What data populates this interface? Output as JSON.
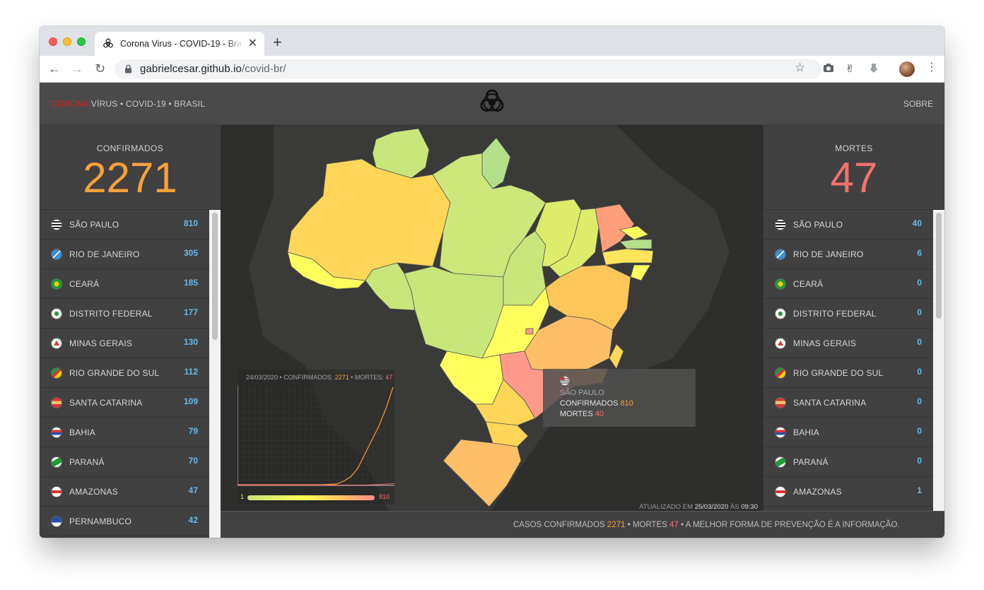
{
  "browser": {
    "tab_title": "Corona Virus - COVID-19 - Bra",
    "url_host": "gabrielcesar.github.io",
    "url_path": "/covid-br/"
  },
  "header": {
    "brand_red": "CORONA",
    "brand_rest": " VÍRUS • COVID-19 • BRASIL",
    "about": "SOBRE",
    "logo_icon": "biohazard-icon"
  },
  "confirmed": {
    "label": "CONFIRMADOS",
    "total": "2271",
    "states": [
      {
        "name": "SÃO PAULO",
        "value": "810"
      },
      {
        "name": "RIO DE JANEIRO",
        "value": "305"
      },
      {
        "name": "CEARÁ",
        "value": "185"
      },
      {
        "name": "DISTRITO FEDERAL",
        "value": "177"
      },
      {
        "name": "MINAS GERAIS",
        "value": "130"
      },
      {
        "name": "RIO GRANDE DO SUL",
        "value": "112"
      },
      {
        "name": "SANTA CATARINA",
        "value": "109"
      },
      {
        "name": "BAHIA",
        "value": "79"
      },
      {
        "name": "PARANÁ",
        "value": "70"
      },
      {
        "name": "AMAZONAS",
        "value": "47"
      },
      {
        "name": "PERNAMBUCO",
        "value": "42"
      }
    ]
  },
  "deaths": {
    "label": "MORTES",
    "total": "47",
    "states": [
      {
        "name": "SÃO PAULO",
        "value": "40"
      },
      {
        "name": "RIO DE JANEIRO",
        "value": "6"
      },
      {
        "name": "CEARÁ",
        "value": "0"
      },
      {
        "name": "DISTRITO FEDERAL",
        "value": "0"
      },
      {
        "name": "MINAS GERAIS",
        "value": "0"
      },
      {
        "name": "RIO GRANDE DO SUL",
        "value": "0"
      },
      {
        "name": "SANTA CATARINA",
        "value": "0"
      },
      {
        "name": "BAHIA",
        "value": "0"
      },
      {
        "name": "PARANÁ",
        "value": "0"
      },
      {
        "name": "AMAZONAS",
        "value": "1"
      }
    ]
  },
  "chart": {
    "date": "24/03/2020",
    "confirmed_label": "CONFIRMADOS:",
    "confirmed_value": "2271",
    "deaths_label": "MORTES:",
    "deaths_value": "47",
    "legend_min": "1",
    "legend_max": "810"
  },
  "tooltip": {
    "state": "SÃO PAULO",
    "confirmed_label": "CONFIRMADOS",
    "confirmed_value": "810",
    "deaths_label": "MORTES",
    "deaths_value": "40"
  },
  "updated": {
    "prefix": "ATUALIZADO EM",
    "date": "25/03/2020",
    "at": "ÀS",
    "time": "09:30"
  },
  "footer": {
    "confirmed_label": "CASOS CONFIRMADOS",
    "confirmed_value": "2271",
    "deaths_label": "• MORTES",
    "deaths_value": "47",
    "tagline": "• A MELHOR FORMA DE PREVENÇÃO É A INFORMAÇÃO."
  },
  "colors": {
    "accent_red": "#e02020",
    "confirmed": "#f7a03a",
    "deaths": "#f4706f",
    "numbers": "#6ab8ea"
  }
}
